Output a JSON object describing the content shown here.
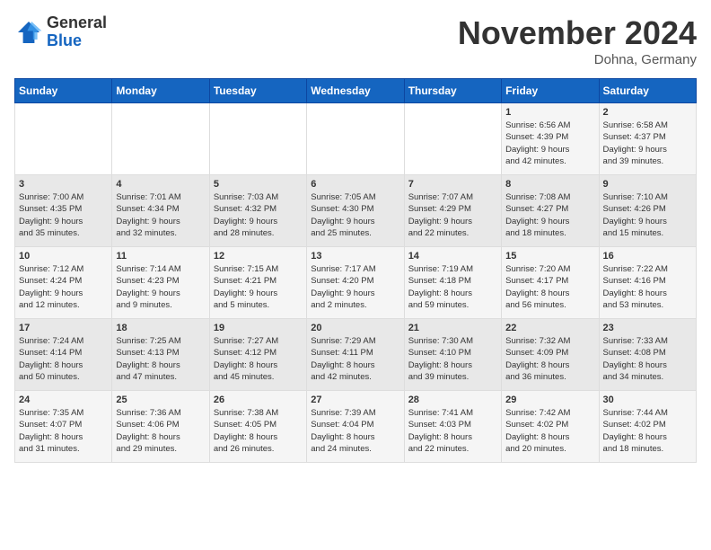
{
  "header": {
    "logo_line1": "General",
    "logo_line2": "Blue",
    "month": "November 2024",
    "location": "Dohna, Germany"
  },
  "days_of_week": [
    "Sunday",
    "Monday",
    "Tuesday",
    "Wednesday",
    "Thursday",
    "Friday",
    "Saturday"
  ],
  "weeks": [
    [
      {
        "day": "",
        "info": ""
      },
      {
        "day": "",
        "info": ""
      },
      {
        "day": "",
        "info": ""
      },
      {
        "day": "",
        "info": ""
      },
      {
        "day": "",
        "info": ""
      },
      {
        "day": "1",
        "info": "Sunrise: 6:56 AM\nSunset: 4:39 PM\nDaylight: 9 hours\nand 42 minutes."
      },
      {
        "day": "2",
        "info": "Sunrise: 6:58 AM\nSunset: 4:37 PM\nDaylight: 9 hours\nand 39 minutes."
      }
    ],
    [
      {
        "day": "3",
        "info": "Sunrise: 7:00 AM\nSunset: 4:35 PM\nDaylight: 9 hours\nand 35 minutes."
      },
      {
        "day": "4",
        "info": "Sunrise: 7:01 AM\nSunset: 4:34 PM\nDaylight: 9 hours\nand 32 minutes."
      },
      {
        "day": "5",
        "info": "Sunrise: 7:03 AM\nSunset: 4:32 PM\nDaylight: 9 hours\nand 28 minutes."
      },
      {
        "day": "6",
        "info": "Sunrise: 7:05 AM\nSunset: 4:30 PM\nDaylight: 9 hours\nand 25 minutes."
      },
      {
        "day": "7",
        "info": "Sunrise: 7:07 AM\nSunset: 4:29 PM\nDaylight: 9 hours\nand 22 minutes."
      },
      {
        "day": "8",
        "info": "Sunrise: 7:08 AM\nSunset: 4:27 PM\nDaylight: 9 hours\nand 18 minutes."
      },
      {
        "day": "9",
        "info": "Sunrise: 7:10 AM\nSunset: 4:26 PM\nDaylight: 9 hours\nand 15 minutes."
      }
    ],
    [
      {
        "day": "10",
        "info": "Sunrise: 7:12 AM\nSunset: 4:24 PM\nDaylight: 9 hours\nand 12 minutes."
      },
      {
        "day": "11",
        "info": "Sunrise: 7:14 AM\nSunset: 4:23 PM\nDaylight: 9 hours\nand 9 minutes."
      },
      {
        "day": "12",
        "info": "Sunrise: 7:15 AM\nSunset: 4:21 PM\nDaylight: 9 hours\nand 5 minutes."
      },
      {
        "day": "13",
        "info": "Sunrise: 7:17 AM\nSunset: 4:20 PM\nDaylight: 9 hours\nand 2 minutes."
      },
      {
        "day": "14",
        "info": "Sunrise: 7:19 AM\nSunset: 4:18 PM\nDaylight: 8 hours\nand 59 minutes."
      },
      {
        "day": "15",
        "info": "Sunrise: 7:20 AM\nSunset: 4:17 PM\nDaylight: 8 hours\nand 56 minutes."
      },
      {
        "day": "16",
        "info": "Sunrise: 7:22 AM\nSunset: 4:16 PM\nDaylight: 8 hours\nand 53 minutes."
      }
    ],
    [
      {
        "day": "17",
        "info": "Sunrise: 7:24 AM\nSunset: 4:14 PM\nDaylight: 8 hours\nand 50 minutes."
      },
      {
        "day": "18",
        "info": "Sunrise: 7:25 AM\nSunset: 4:13 PM\nDaylight: 8 hours\nand 47 minutes."
      },
      {
        "day": "19",
        "info": "Sunrise: 7:27 AM\nSunset: 4:12 PM\nDaylight: 8 hours\nand 45 minutes."
      },
      {
        "day": "20",
        "info": "Sunrise: 7:29 AM\nSunset: 4:11 PM\nDaylight: 8 hours\nand 42 minutes."
      },
      {
        "day": "21",
        "info": "Sunrise: 7:30 AM\nSunset: 4:10 PM\nDaylight: 8 hours\nand 39 minutes."
      },
      {
        "day": "22",
        "info": "Sunrise: 7:32 AM\nSunset: 4:09 PM\nDaylight: 8 hours\nand 36 minutes."
      },
      {
        "day": "23",
        "info": "Sunrise: 7:33 AM\nSunset: 4:08 PM\nDaylight: 8 hours\nand 34 minutes."
      }
    ],
    [
      {
        "day": "24",
        "info": "Sunrise: 7:35 AM\nSunset: 4:07 PM\nDaylight: 8 hours\nand 31 minutes."
      },
      {
        "day": "25",
        "info": "Sunrise: 7:36 AM\nSunset: 4:06 PM\nDaylight: 8 hours\nand 29 minutes."
      },
      {
        "day": "26",
        "info": "Sunrise: 7:38 AM\nSunset: 4:05 PM\nDaylight: 8 hours\nand 26 minutes."
      },
      {
        "day": "27",
        "info": "Sunrise: 7:39 AM\nSunset: 4:04 PM\nDaylight: 8 hours\nand 24 minutes."
      },
      {
        "day": "28",
        "info": "Sunrise: 7:41 AM\nSunset: 4:03 PM\nDaylight: 8 hours\nand 22 minutes."
      },
      {
        "day": "29",
        "info": "Sunrise: 7:42 AM\nSunset: 4:02 PM\nDaylight: 8 hours\nand 20 minutes."
      },
      {
        "day": "30",
        "info": "Sunrise: 7:44 AM\nSunset: 4:02 PM\nDaylight: 8 hours\nand 18 minutes."
      }
    ]
  ]
}
